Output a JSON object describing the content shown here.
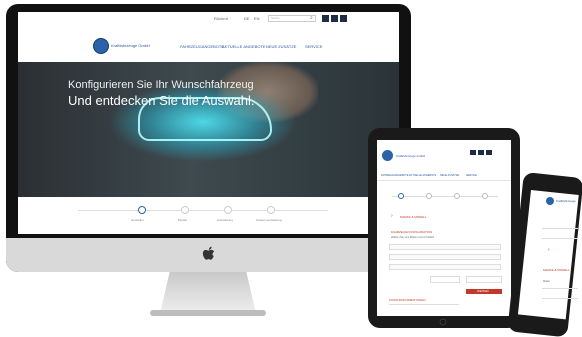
{
  "desktop": {
    "topbar": {
      "links": [
        "Rückruf",
        "DE",
        "EN"
      ],
      "search_placeholder": "Suche",
      "social": [
        "facebook-icon",
        "twitter-icon",
        "youtube-icon"
      ]
    },
    "logo_text": "Kraftfahrzeuge GmbH",
    "nav": [
      "FAHRZEUGANGEBOTE",
      "AKTUELLE ANGEBOTE",
      "NEUE ZUSÄTZE",
      "SERVICE"
    ],
    "hero": {
      "line1": "Konfigurieren Sie Ihr Wunschfahrzeug",
      "line2": "Und entdecken Sie die Auswahl."
    },
    "steps": [
      "Hersteller",
      "Modell",
      "Ausstattung",
      "Zusammenfassung"
    ]
  },
  "tablet": {
    "logo_text": "Kraftfahrzeuge GmbH",
    "nav": [
      "FAHRZEUGANGEBOTE",
      "AKTUELLE ANGEBOTE",
      "NEUE ZUSÄTZE",
      "SERVICE"
    ],
    "section_title": "MARKE & MODELL",
    "form_heading": "FAHRZEUGKONFIGURATION",
    "form_hint": "Wählen Sie eine Marke und ein Modell",
    "button_label": "WEITER",
    "footer_heading": "ZUSATZINFORMATIONEN"
  },
  "phone": {
    "logo_text": "Kraftfahrzeuge",
    "section_title": "MARKE & MODELL",
    "label": "Marke"
  },
  "colors": {
    "brand": "#2a63a8",
    "accent": "#c0392b",
    "dark": "#1d2b44"
  }
}
